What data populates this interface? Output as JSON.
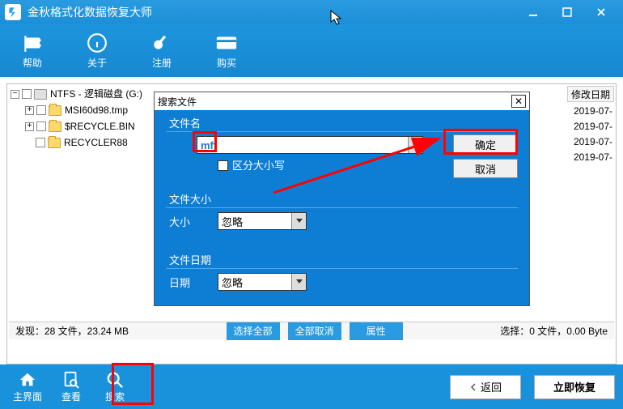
{
  "window": {
    "title": "金秋格式化数据恢复大师"
  },
  "toolbar": {
    "help": "帮助",
    "about": "关于",
    "register": "注册",
    "buy": "购买"
  },
  "tree": {
    "root": "NTFS - 逻辑磁盘 (G:)",
    "items": [
      "MSI60d98.tmp",
      "$RECYCLE.BIN",
      "RECYCLER88"
    ]
  },
  "list": {
    "header_date": "修改日期",
    "rows": [
      "2019-07-",
      "2019-07-",
      "2019-07-",
      "2019-07-"
    ]
  },
  "status": {
    "found": "发现：28 文件，23.24 MB",
    "select_all": "选择全部",
    "deselect_all": "全部取消",
    "properties": "属性",
    "selected": "选择：0 文件，0.00 Byte"
  },
  "dialog": {
    "title": "搜索文件",
    "filename_label": "文件名",
    "filename_value": "mft",
    "case_label": "区分大小写",
    "ok": "确定",
    "cancel": "取消",
    "size_group": "文件大小",
    "size_label": "大小",
    "size_value": "忽略",
    "date_group": "文件日期",
    "date_label": "日期",
    "date_value": "忽略"
  },
  "bottom": {
    "home": "主界面",
    "view": "查看",
    "search": "搜索",
    "back": "返回",
    "recover": "立即恢复"
  }
}
